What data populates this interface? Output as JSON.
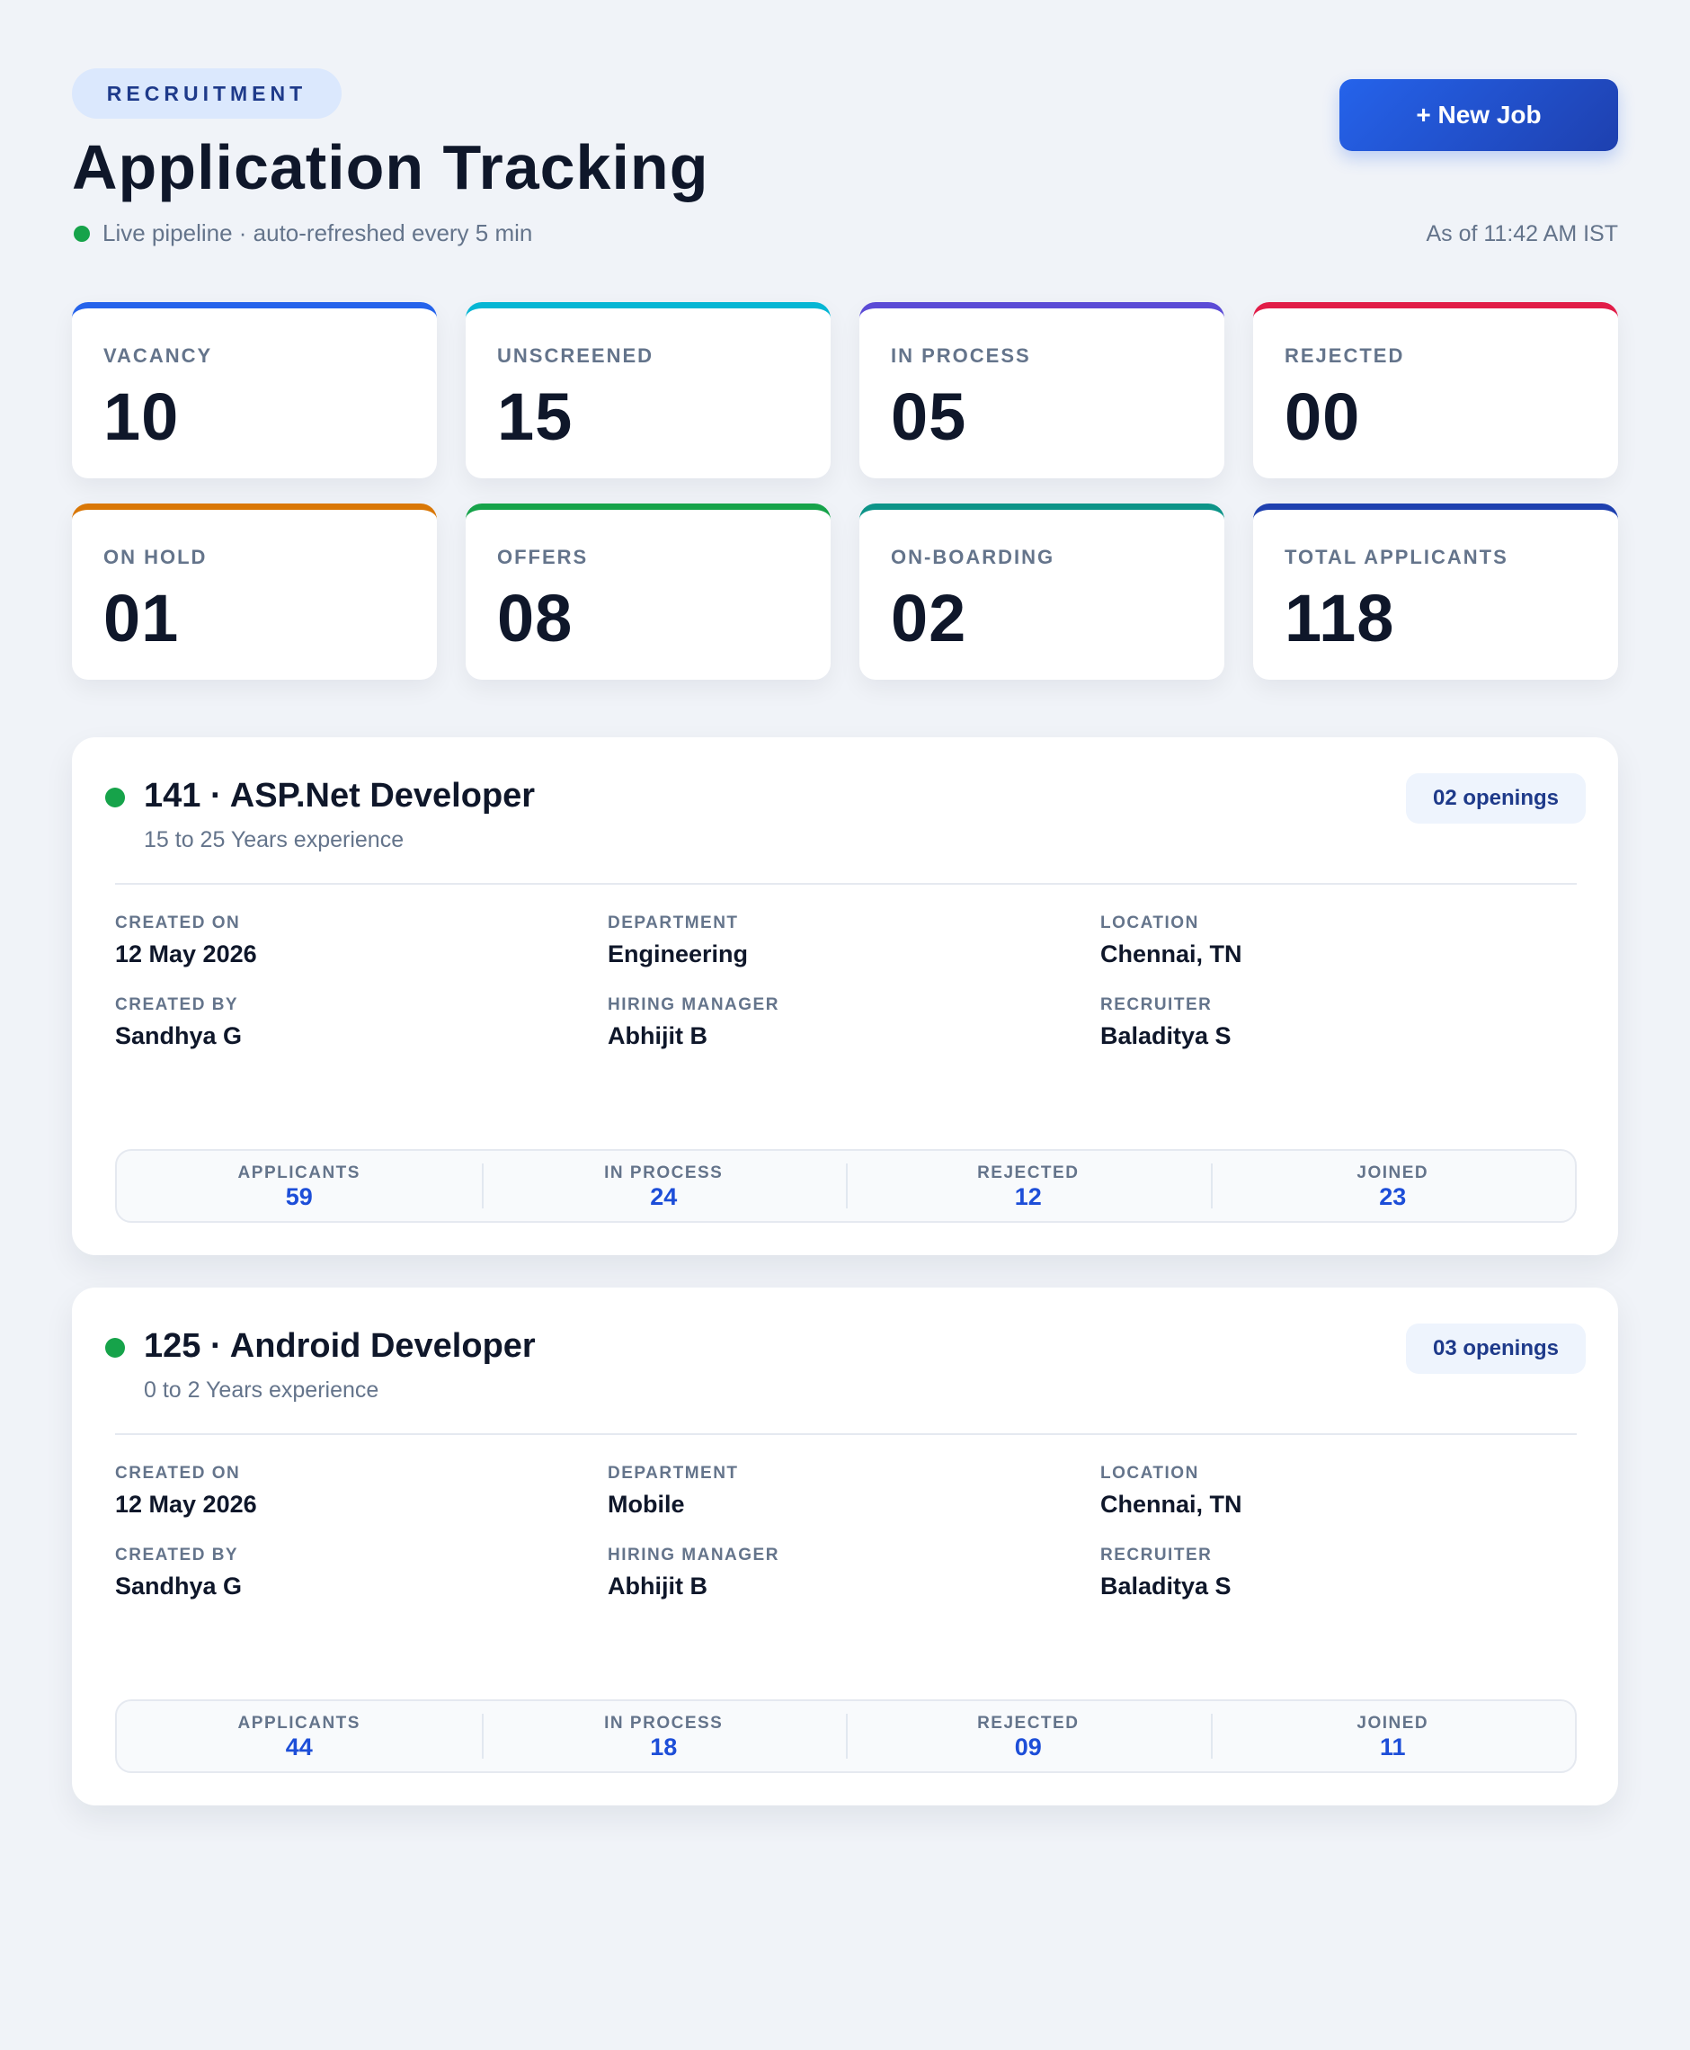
{
  "header": {
    "eyebrow": "RECRUITMENT",
    "title": "Application Tracking",
    "status_text": "Live pipeline · auto-refreshed every 5 min",
    "new_job_label": "+ New Job",
    "as_of": "As of 11:42 AM IST"
  },
  "colors": {
    "live_dot": "#16a34a",
    "primary": "#2563eb"
  },
  "stats": [
    {
      "label": "VACANCY",
      "value": "10",
      "accent": "#2563eb"
    },
    {
      "label": "UNSCREENED",
      "value": "15",
      "accent": "#06b6d4"
    },
    {
      "label": "IN PROCESS",
      "value": "05",
      "accent": "#5b4bd6"
    },
    {
      "label": "REJECTED",
      "value": "00",
      "accent": "#e11d48"
    },
    {
      "label": "ON HOLD",
      "value": "01",
      "accent": "#d97706"
    },
    {
      "label": "OFFERS",
      "value": "08",
      "accent": "#16a34a"
    },
    {
      "label": "ON-BOARDING",
      "value": "02",
      "accent": "#0d9488"
    },
    {
      "label": "TOTAL APPLICANTS",
      "value": "118",
      "accent": "#1e40af"
    }
  ],
  "jobs": [
    {
      "title": "141 · ASP.Net Developer",
      "experience": "15 to 25 Years experience",
      "openings": "02 openings",
      "details": [
        {
          "label": "CREATED ON",
          "value": "12 May 2026"
        },
        {
          "label": "DEPARTMENT",
          "value": "Engineering"
        },
        {
          "label": "LOCATION",
          "value": "Chennai, TN"
        },
        {
          "label": "CREATED BY",
          "value": "Sandhya G"
        },
        {
          "label": "HIRING MANAGER",
          "value": "Abhijit B"
        },
        {
          "label": "RECRUITER",
          "value": "Baladitya S"
        }
      ],
      "metrics": [
        {
          "label": "APPLICANTS",
          "value": "59"
        },
        {
          "label": "IN PROCESS",
          "value": "24"
        },
        {
          "label": "REJECTED",
          "value": "12"
        },
        {
          "label": "JOINED",
          "value": "23"
        }
      ]
    },
    {
      "title": "125 · Android Developer",
      "experience": "0 to 2 Years experience",
      "openings": "03 openings",
      "details": [
        {
          "label": "CREATED ON",
          "value": "12 May 2026"
        },
        {
          "label": "DEPARTMENT",
          "value": "Mobile"
        },
        {
          "label": "LOCATION",
          "value": "Chennai, TN"
        },
        {
          "label": "CREATED BY",
          "value": "Sandhya G"
        },
        {
          "label": "HIRING MANAGER",
          "value": "Abhijit B"
        },
        {
          "label": "RECRUITER",
          "value": "Baladitya S"
        }
      ],
      "metrics": [
        {
          "label": "APPLICANTS",
          "value": "44"
        },
        {
          "label": "IN PROCESS",
          "value": "18"
        },
        {
          "label": "REJECTED",
          "value": "09"
        },
        {
          "label": "JOINED",
          "value": "11"
        }
      ]
    }
  ]
}
